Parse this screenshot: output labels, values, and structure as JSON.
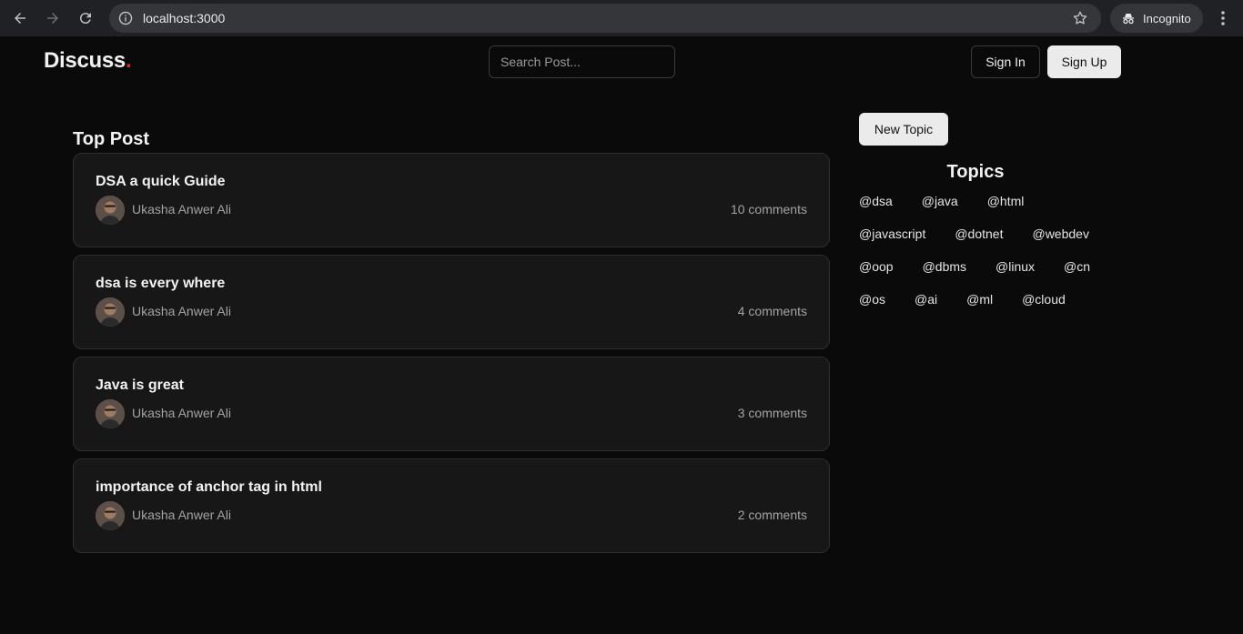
{
  "browser": {
    "url": "localhost:3000",
    "incognito_label": "Incognito",
    "icons": [
      "back-icon",
      "forward-icon",
      "reload-icon",
      "info-icon",
      "star-icon",
      "incognito-icon",
      "more-vert-icon"
    ]
  },
  "header": {
    "logo_text": "Discuss",
    "logo_dot": ".",
    "logo_dot_color": "#e5262c",
    "search_placeholder": "Search Post...",
    "sign_in_label": "Sign In",
    "sign_up_label": "Sign Up"
  },
  "main": {
    "section_title": "Top Post",
    "posts": [
      {
        "title": "DSA a quick Guide",
        "author": "Ukasha Anwer Ali",
        "comments": "10 comments"
      },
      {
        "title": "dsa is every where",
        "author": "Ukasha Anwer Ali",
        "comments": "4 comments"
      },
      {
        "title": "Java is great",
        "author": "Ukasha Anwer Ali",
        "comments": "3 comments"
      },
      {
        "title": "importance of anchor tag in html",
        "author": "Ukasha Anwer Ali",
        "comments": "2 comments"
      }
    ]
  },
  "sidebar": {
    "new_topic_label": "New Topic",
    "topics_title": "Topics",
    "topics": [
      "@dsa",
      "@java",
      "@html",
      "@javascript",
      "@dotnet",
      "@webdev",
      "@oop",
      "@dbms",
      "@linux",
      "@cn",
      "@os",
      "@ai",
      "@ml",
      "@cloud"
    ]
  }
}
